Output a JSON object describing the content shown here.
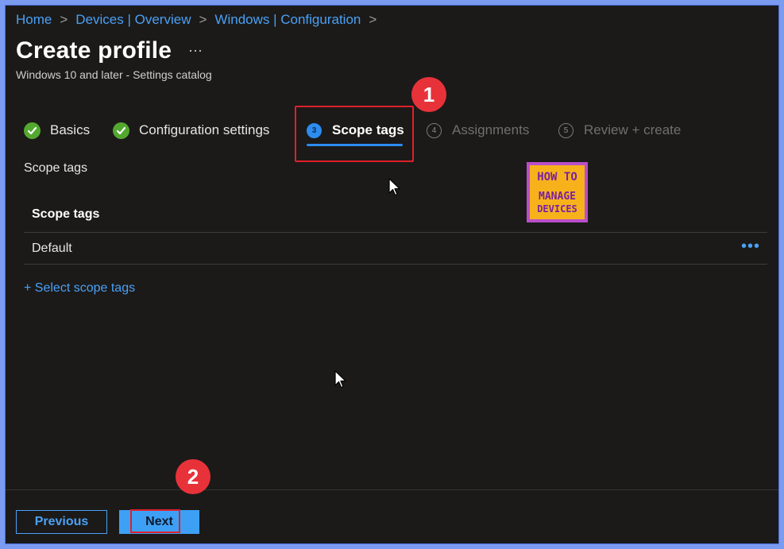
{
  "breadcrumb": [
    {
      "label": "Home"
    },
    {
      "label": "Devices | Overview"
    },
    {
      "label": "Windows | Configuration"
    }
  ],
  "page": {
    "title": "Create profile",
    "more": "···",
    "subtitle": "Windows 10 and later - Settings catalog"
  },
  "wizard": {
    "steps": [
      {
        "label": "Basics",
        "state": "done"
      },
      {
        "label": "Configuration settings",
        "state": "done"
      },
      {
        "label": "Scope tags",
        "number": "3",
        "state": "active"
      },
      {
        "label": "Assignments",
        "number": "4",
        "state": "pending"
      },
      {
        "label": "Review + create",
        "number": "5",
        "state": "pending"
      }
    ]
  },
  "scope": {
    "section_label": "Scope tags",
    "table_header": "Scope tags",
    "rows": [
      {
        "label": "Default",
        "more": "•••"
      }
    ],
    "select_link": "+ Select scope tags"
  },
  "logo": {
    "line1": "HOW TO",
    "line2": "MANAGE",
    "line3": "DEVICES"
  },
  "annotations": {
    "badge1": "1",
    "badge2": "2"
  },
  "footer": {
    "previous_label": "Previous",
    "next_label": "Next"
  },
  "colors": {
    "accent": "#2c8cf0",
    "link": "#4aa0f5",
    "success": "#53a82f",
    "highlight": "#e0202a",
    "background": "#1b1a19"
  }
}
